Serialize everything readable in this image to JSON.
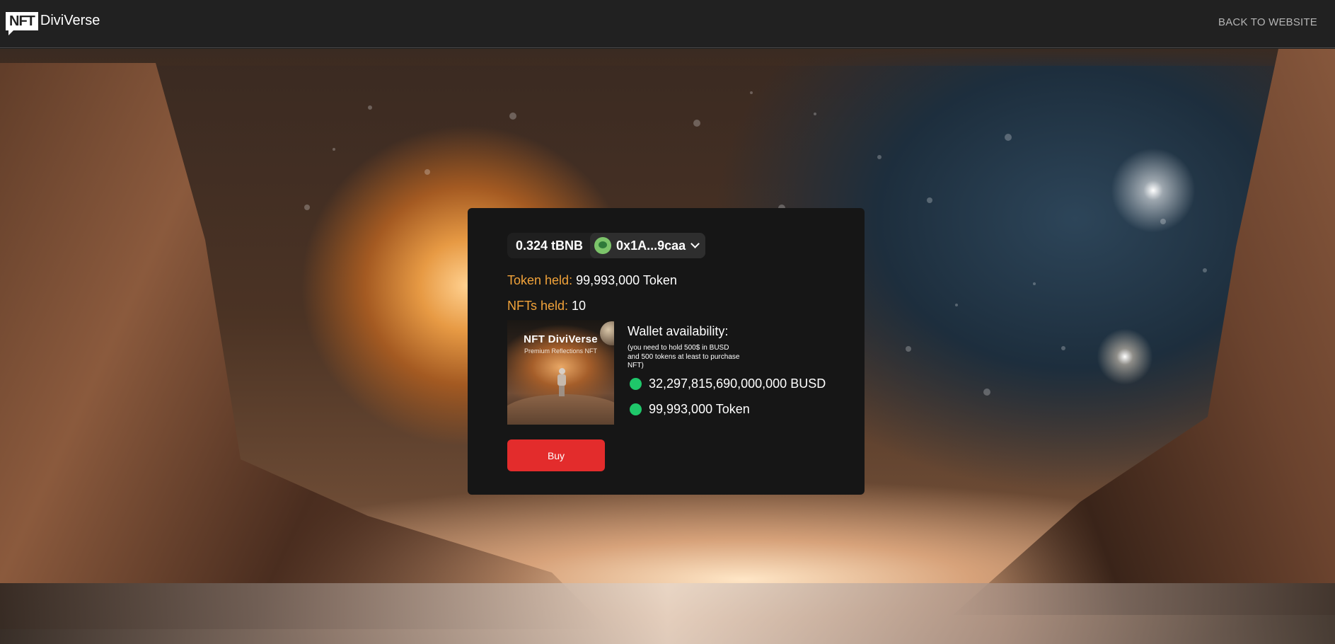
{
  "header": {
    "logo_badge": "NFT",
    "logo_text": "DiviVerse",
    "back_link": "BACK TO WEBSITE"
  },
  "wallet": {
    "balance": "0.324 tBNB",
    "address": "0x1A...9caa",
    "avatar_icon": "wallet-avatar-icon",
    "dropdown_icon": "chevron-down-icon"
  },
  "holdings": {
    "token_label": "Token held:",
    "token_value": "99,993,000 Token",
    "nfts_label": "NFTs held:",
    "nfts_value": "10"
  },
  "nft_card": {
    "title": "NFT DiviVerse",
    "subtitle": "Premium Reflections NFT"
  },
  "availability": {
    "title": "Wallet availability:",
    "note": "(you need to hold 500$ in BUSD and 500 tokens at least to purchase NFT)",
    "items": [
      {
        "value": "32,297,815,690,000,000 BUSD",
        "status_color": "#1fc76a"
      },
      {
        "value": "99,993,000 Token",
        "status_color": "#1fc76a"
      }
    ]
  },
  "actions": {
    "buy_label": "Buy",
    "buy_color": "#e32c2c"
  },
  "colors": {
    "label_accent": "#f2a33a",
    "card_bg": "#161616",
    "topbar_bg": "#212121"
  }
}
